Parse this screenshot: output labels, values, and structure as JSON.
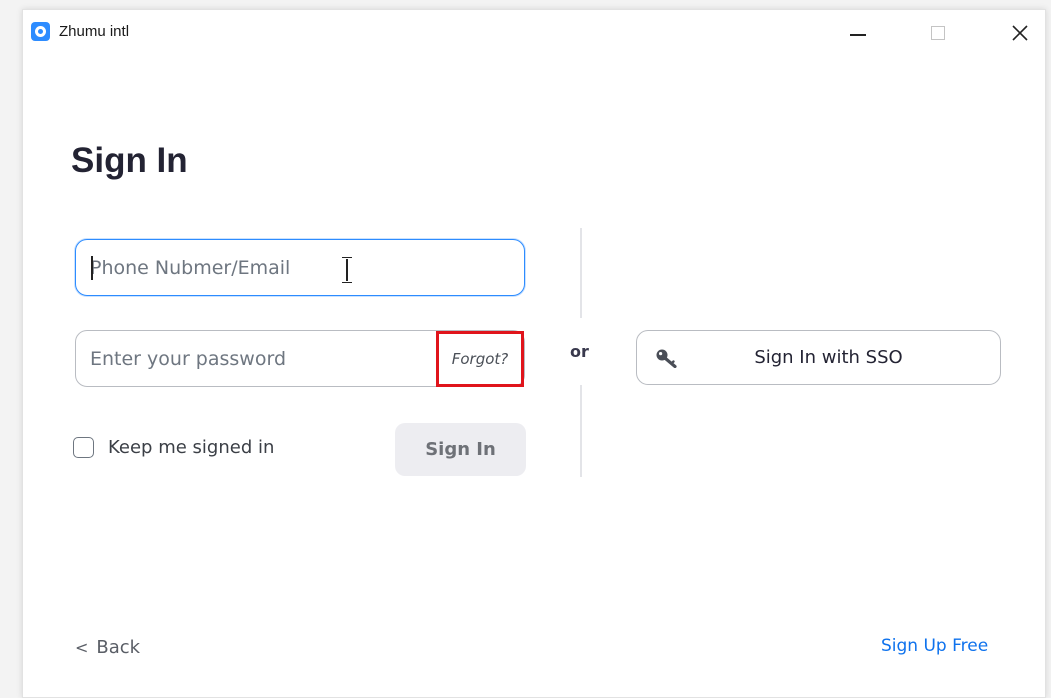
{
  "window": {
    "app_title": "Zhumu intl",
    "controls": {
      "minimize": "—",
      "maximize": "□",
      "close": "✕"
    }
  },
  "signin": {
    "heading": "Sign In",
    "email_placeholder": "Phone Nubmer/Email",
    "password_placeholder": "Enter your password",
    "forgot_label": "Forgot?",
    "keep_signed_in_label": "Keep me signed in",
    "submit_label": "Sign In"
  },
  "alt": {
    "or_label": "or",
    "sso_label": "Sign In with SSO"
  },
  "footer": {
    "back_label": "Back",
    "signup_label": "Sign Up Free"
  },
  "colors": {
    "accent": "#2d8cff",
    "link": "#0e72ed",
    "highlight": "#e0141b"
  }
}
